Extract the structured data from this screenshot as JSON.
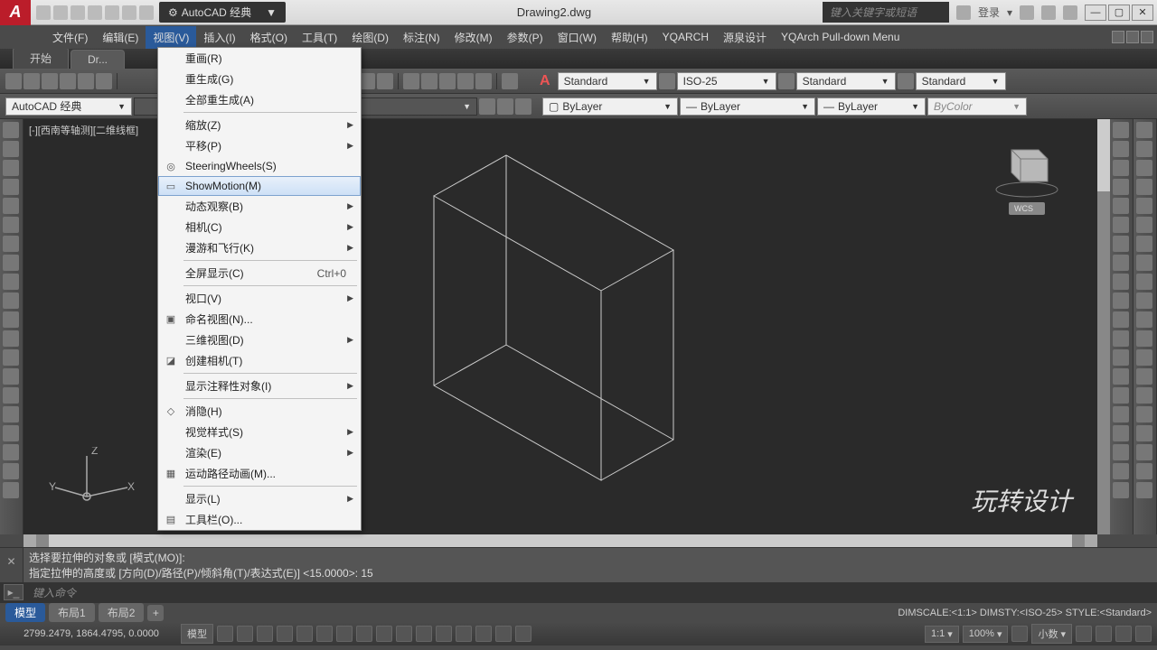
{
  "titlebar": {
    "workspace": "AutoCAD 经典",
    "document": "Drawing2.dwg",
    "search_placeholder": "键入关键字或短语",
    "login": "登录"
  },
  "menubar": {
    "items": [
      "文件(F)",
      "编辑(E)",
      "视图(V)",
      "插入(I)",
      "格式(O)",
      "工具(T)",
      "绘图(D)",
      "标注(N)",
      "修改(M)",
      "参数(P)",
      "窗口(W)",
      "帮助(H)",
      "YQARCH",
      "源泉设计",
      "YQArch Pull-down Menu"
    ],
    "active_index": 2
  },
  "doctabs": {
    "items": [
      "开始",
      "Dr..."
    ],
    "active_index": 1
  },
  "dropdown": {
    "items": [
      {
        "label": "重画(R)",
        "icon": "",
        "arrow": false
      },
      {
        "label": "重生成(G)",
        "icon": "",
        "arrow": false
      },
      {
        "label": "全部重生成(A)",
        "icon": "",
        "arrow": false
      },
      {
        "sep": true
      },
      {
        "label": "缩放(Z)",
        "icon": "",
        "arrow": true
      },
      {
        "label": "平移(P)",
        "icon": "",
        "arrow": true
      },
      {
        "label": "SteeringWheels(S)",
        "icon": "◎",
        "arrow": false
      },
      {
        "label": "ShowMotion(M)",
        "icon": "▭",
        "arrow": false,
        "highlight": true
      },
      {
        "label": "动态观察(B)",
        "icon": "",
        "arrow": true
      },
      {
        "label": "相机(C)",
        "icon": "",
        "arrow": true
      },
      {
        "label": "漫游和飞行(K)",
        "icon": "",
        "arrow": true
      },
      {
        "sep": true
      },
      {
        "label": "全屏显示(C)",
        "shortcut": "Ctrl+0",
        "arrow": false
      },
      {
        "sep": true
      },
      {
        "label": "视口(V)",
        "icon": "",
        "arrow": true
      },
      {
        "label": "命名视图(N)...",
        "icon": "▣",
        "arrow": false
      },
      {
        "label": "三维视图(D)",
        "icon": "",
        "arrow": true
      },
      {
        "label": "创建相机(T)",
        "icon": "◪",
        "arrow": false
      },
      {
        "sep": true
      },
      {
        "label": "显示注释性对象(I)",
        "icon": "",
        "arrow": true
      },
      {
        "sep": true
      },
      {
        "label": "消隐(H)",
        "icon": "◇",
        "arrow": false
      },
      {
        "label": "视觉样式(S)",
        "icon": "",
        "arrow": true
      },
      {
        "label": "渲染(E)",
        "icon": "",
        "arrow": true
      },
      {
        "label": "运动路径动画(M)...",
        "icon": "▦",
        "arrow": false
      },
      {
        "sep": true
      },
      {
        "label": "显示(L)",
        "icon": "",
        "arrow": true
      },
      {
        "label": "工具栏(O)...",
        "icon": "▤",
        "arrow": false
      }
    ]
  },
  "toolbars": {
    "workspace_combo": "AutoCAD 经典",
    "text_style": "Standard",
    "dim_style": "ISO-25",
    "mleader_style": "Standard",
    "table_style": "Standard",
    "layer_combo": "ByLayer",
    "color_combo": "ByLayer",
    "linetype_combo": "ByLayer",
    "plot_style": "ByColor"
  },
  "canvas": {
    "viewport_label": "[-][西南等轴测][二维线框]",
    "wcs_label": "WCS",
    "ucs_x": "X",
    "ucs_y": "Y",
    "ucs_z": "Z",
    "watermark": "玩转设计"
  },
  "command": {
    "history1": "选择要拉伸的对象或 [模式(MO)]:",
    "history2": "指定拉伸的高度或 [方向(D)/路径(P)/倾斜角(T)/表达式(E)] <15.0000>: 15",
    "prompt": "键入命令"
  },
  "layout_tabs": {
    "items": [
      "模型",
      "布局1",
      "布局2"
    ],
    "active_index": 0,
    "dimscale": "DIMSCALE:<1:1>  DIMSTY:<ISO-25>  STYLE:<Standard>"
  },
  "statusbar": {
    "coordinates": "2799.2479, 1864.4795, 0.0000",
    "units": "模型",
    "scale": "1:1",
    "zoom": "100%",
    "decimal": "小数"
  }
}
